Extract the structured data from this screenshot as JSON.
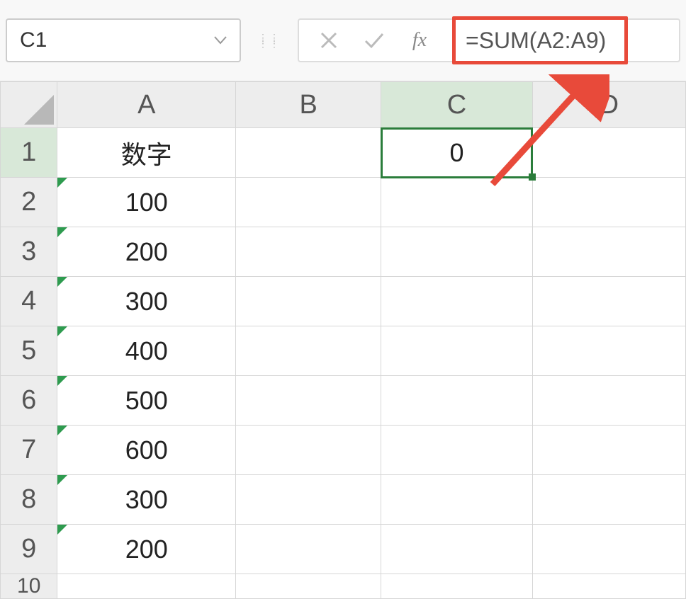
{
  "nameBox": {
    "value": "C1"
  },
  "formulaBar": {
    "formula": "=SUM(A2:A9)",
    "fxLabel": "fx"
  },
  "columns": [
    "A",
    "B",
    "C",
    "D"
  ],
  "rowNumbers": [
    "1",
    "2",
    "3",
    "4",
    "5",
    "6",
    "7",
    "8",
    "9",
    "10"
  ],
  "selectedCell": {
    "row": 1,
    "col": "C"
  },
  "cells": {
    "A1": {
      "value": "数字",
      "textMarker": false
    },
    "A2": {
      "value": "100",
      "textMarker": true
    },
    "A3": {
      "value": "200",
      "textMarker": true
    },
    "A4": {
      "value": "300",
      "textMarker": true
    },
    "A5": {
      "value": "400",
      "textMarker": true
    },
    "A6": {
      "value": "500",
      "textMarker": true
    },
    "A7": {
      "value": "600",
      "textMarker": true
    },
    "A8": {
      "value": "300",
      "textMarker": true
    },
    "A9": {
      "value": "200",
      "textMarker": true
    },
    "C1": {
      "value": "0",
      "textMarker": false
    }
  },
  "annotation": {
    "highlightColor": "#e84a3a"
  }
}
